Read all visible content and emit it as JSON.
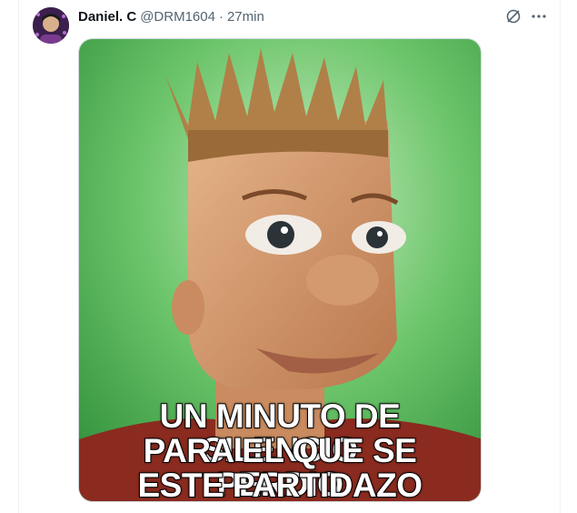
{
  "tweet": {
    "display_name": "Daniel. C",
    "handle": "@DRM1604",
    "separator": "·",
    "time": "27min"
  },
  "actions": {
    "grok_icon": "grok-icon",
    "more_icon": "more-icon"
  },
  "media": {
    "caption_lines": [
      "UN MINUTO DE SILENCIO",
      "PARA EL QUE SE PERDIO",
      "ESTE PARTIDAZO"
    ]
  },
  "colors": {
    "text_primary": "#0f1419",
    "text_secondary": "#536471",
    "border": "#cfd9de",
    "meme_background": "#5cb85c"
  }
}
